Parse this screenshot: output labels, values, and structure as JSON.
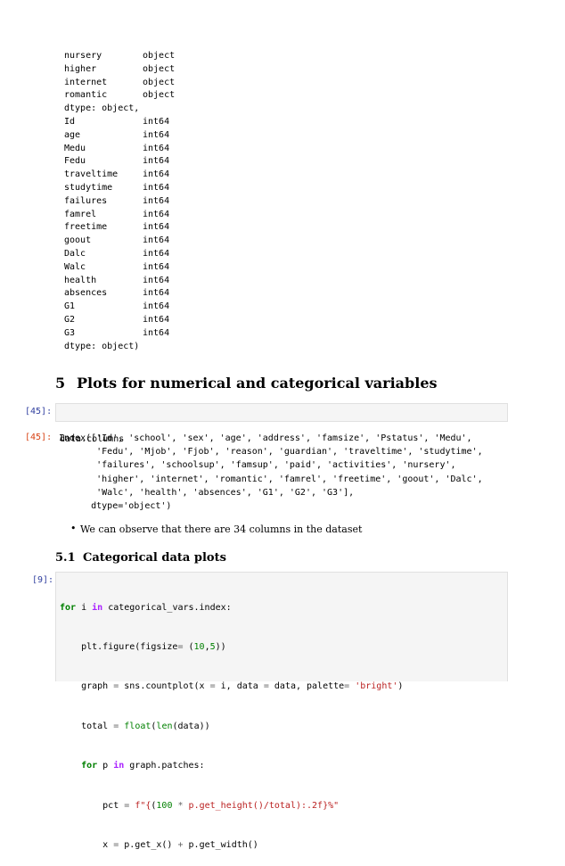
{
  "dtype_output": {
    "object_rows": [
      {
        "name": "nursery",
        "dtype": "object"
      },
      {
        "name": "higher",
        "dtype": "object"
      },
      {
        "name": "internet",
        "dtype": "object"
      },
      {
        "name": "romantic",
        "dtype": "object"
      }
    ],
    "object_dtype_footer": "dtype: object,",
    "int_rows": [
      {
        "name": "Id",
        "dtype": "int64"
      },
      {
        "name": "age",
        "dtype": "int64"
      },
      {
        "name": "Medu",
        "dtype": "int64"
      },
      {
        "name": "Fedu",
        "dtype": "int64"
      },
      {
        "name": "traveltime",
        "dtype": "int64"
      },
      {
        "name": "studytime",
        "dtype": "int64"
      },
      {
        "name": "failures",
        "dtype": "int64"
      },
      {
        "name": "famrel",
        "dtype": "int64"
      },
      {
        "name": "freetime",
        "dtype": "int64"
      },
      {
        "name": "goout",
        "dtype": "int64"
      },
      {
        "name": "Dalc",
        "dtype": "int64"
      },
      {
        "name": "Walc",
        "dtype": "int64"
      },
      {
        "name": "health",
        "dtype": "int64"
      },
      {
        "name": "absences",
        "dtype": "int64"
      },
      {
        "name": "G1",
        "dtype": "int64"
      },
      {
        "name": "G2",
        "dtype": "int64"
      },
      {
        "name": "G3",
        "dtype": "int64"
      }
    ],
    "int_dtype_footer": "dtype: object)"
  },
  "section": {
    "number": "5",
    "title": "Plots for numerical and categorical variables"
  },
  "cell_45": {
    "in_prompt": "[45]:",
    "code": "data.columns",
    "out_prompt": "[45]:",
    "output_lines": [
      "Index(['Id', 'school', 'sex', 'age', 'address', 'famsize', 'Pstatus', 'Medu',",
      "       'Fedu', 'Mjob', 'Fjob', 'reason', 'guardian', 'traveltime', 'studytime',",
      "       'failures', 'schoolsup', 'famsup', 'paid', 'activities', 'nursery',",
      "       'higher', 'internet', 'romantic', 'famrel', 'freetime', 'goout', 'Dalc',",
      "       'Walc', 'health', 'absences', 'G1', 'G2', 'G3'],",
      "      dtype='object')"
    ]
  },
  "bullet": {
    "marker": "•",
    "text": "We can observe that there are 34 columns in the dataset"
  },
  "subsection": {
    "number": "5.1",
    "title": "Categorical data plots"
  },
  "cell_9": {
    "in_prompt": "[9]:",
    "line1": {
      "kw_for": "for",
      "a": " i ",
      "kw_in": "in",
      "b": " categorical_vars.index:"
    },
    "line2": {
      "a": "    plt.figure(figsize",
      "eq": "=",
      "b": " (",
      "n1": "10",
      "c": ",",
      "n2": "5",
      "d": "))"
    },
    "line3": {
      "a": "    graph ",
      "eq": "=",
      "b": " sns.countplot(x ",
      "eq2": "=",
      "c": " i, data ",
      "eq3": "=",
      "d": " data, palette",
      "eq4": "=",
      "e": " ",
      "s": "'bright'",
      "f": ")"
    },
    "line4": {
      "a": "    total ",
      "eq": "=",
      "b": " ",
      "fn": "float",
      "c": "(",
      "fn2": "len",
      "d": "(data))"
    },
    "line5": {
      "a": "    ",
      "kw_for": "for",
      "b": " p ",
      "kw_in": "in",
      "c": " graph.patches:"
    },
    "line6": {
      "a": "        pct ",
      "eq": "=",
      "b": " ",
      "s1": "f\"{",
      "c": "(",
      "n": "100",
      "d": " ",
      "mul": "*",
      "e": " p.get_height()/total):.2f}%\""
    },
    "line7": {
      "a": "        x ",
      "eq": "=",
      "b": " p.get_x() ",
      "plus": "+",
      "c": " p.get_width()"
    }
  }
}
